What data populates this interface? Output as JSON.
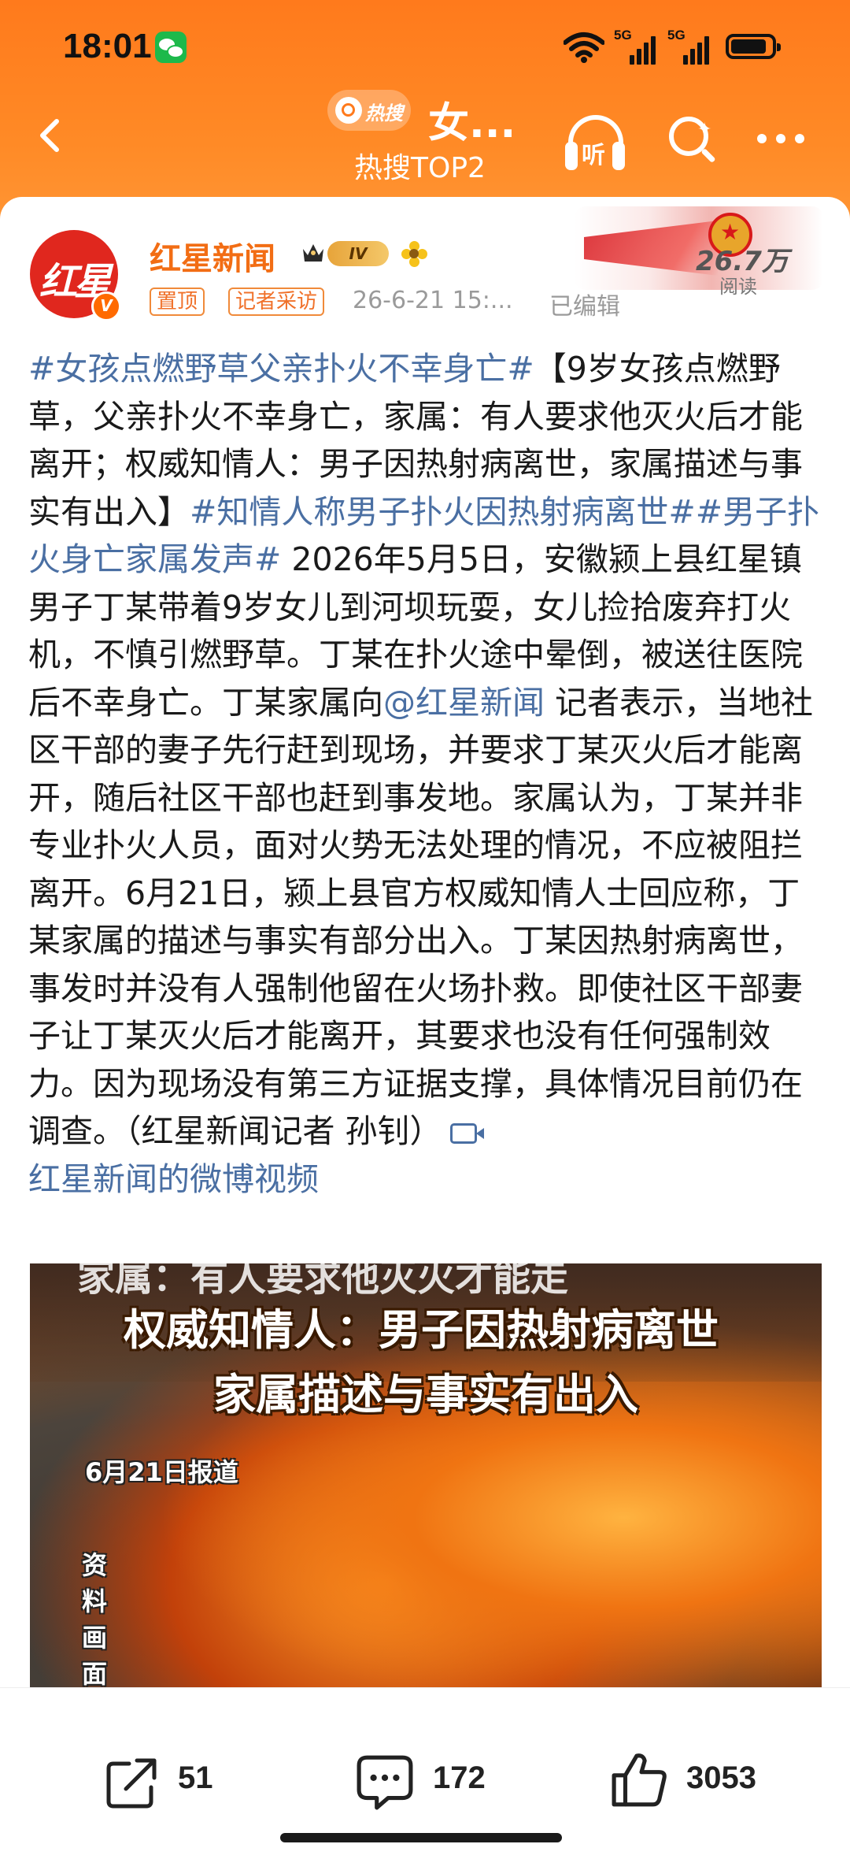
{
  "status": {
    "time": "18:01",
    "net1": "5G",
    "net2": "5G"
  },
  "nav": {
    "hot_label": "热搜",
    "title": "女...",
    "subtitle": "热搜TOP2",
    "listen_label": "听"
  },
  "author": {
    "name": "红星新闻",
    "avatar_text": "红星",
    "level": "IV",
    "tags": [
      "置顶",
      "记者采访"
    ],
    "date": "26-6-21 15:...",
    "edited": "已编辑",
    "reads_count": "26.7万",
    "reads_label": "阅读"
  },
  "post": {
    "t1": "#女孩点燃野草父亲扑火不幸身亡#",
    "t2": "【9岁女孩点燃野草，父亲扑火不幸身亡，家属：有人要求他灭火后才能离开；权威知情人：男子因热射病离世，家属描述与事实有出入】",
    "t3": "#知情人称男子扑火因热射病离世#",
    "t4": "#男子扑火身亡家属发声#",
    "t5": " 2026年5月5日，安徽颍上县红星镇男子丁某带着9岁女儿到河坝玩耍，女儿捡拾废弃打火机，不慎引燃野草。丁某在扑火途中晕倒，被送往医院后不幸身亡。丁某家属向",
    "t6": "@红星新闻",
    "t7": " 记者表示，当地社区干部的妻子先行赶到现场，并要求丁某灭火后才能离开，随后社区干部也赶到事发地。家属认为，丁某并非专业扑火人员，面对火势无法处理的情况，不应被阻拦离开。6月21日，颍上县官方权威知情人士回应称，丁某家属的描述与事实有部分出入。丁某因热射病离世，事发时并没有人强制他留在火场扑救。即使社区干部妻子让丁某灭火后才能离开，其要求也没有任何强制效力。因为现场没有第三方证据支撑，具体情况目前仍在调查。（红星新闻记者 孙钊）",
    "video_link": "红星新闻的微博视频"
  },
  "video": {
    "caption_top": "家属：有人要求他灭火才能走",
    "caption_line1": "权威知情人：男子因热射病离世",
    "caption_line2": "家属描述与事实有出入",
    "report_date": "6月21日报道",
    "archive_label": "资料画面"
  },
  "actions": {
    "share_count": "51",
    "comment_count": "172",
    "like_count": "3053"
  },
  "colors": {
    "accent": "#ff7a1c",
    "link": "#4a6fa3",
    "author": "#f26d14"
  }
}
